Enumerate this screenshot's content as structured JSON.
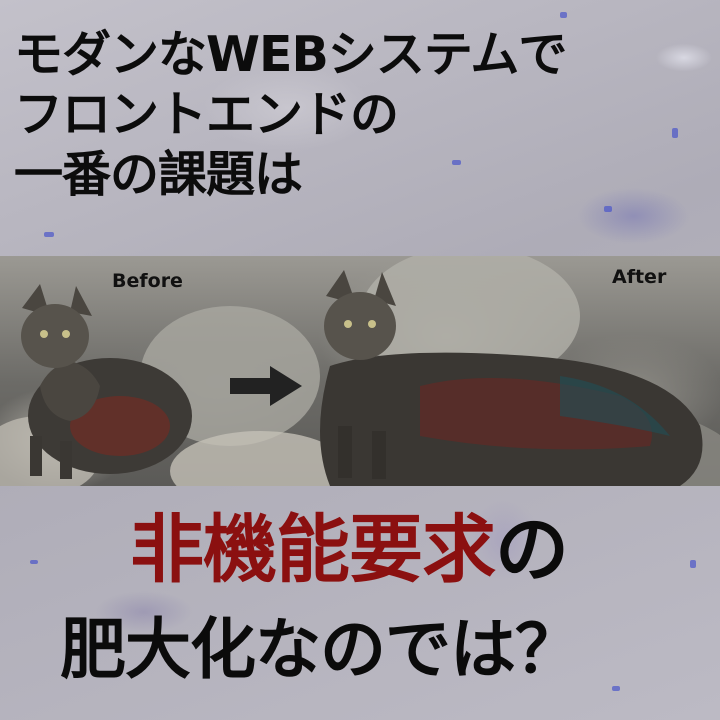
{
  "headline": {
    "line1": "モダンなWEBシステムで",
    "line2": "フロントエンドの",
    "line3": "一番の課題は"
  },
  "comparison": {
    "before_label": "Before",
    "after_label": "After"
  },
  "callout": {
    "emphasis": "非機能要求",
    "particle": "の",
    "line2": "肥大化なのでは？"
  },
  "colors": {
    "emphasis": "#8b1010",
    "text": "#0b0b0b",
    "arrow": "#222222"
  },
  "icons": {
    "arrow": "right-arrow-icon"
  }
}
